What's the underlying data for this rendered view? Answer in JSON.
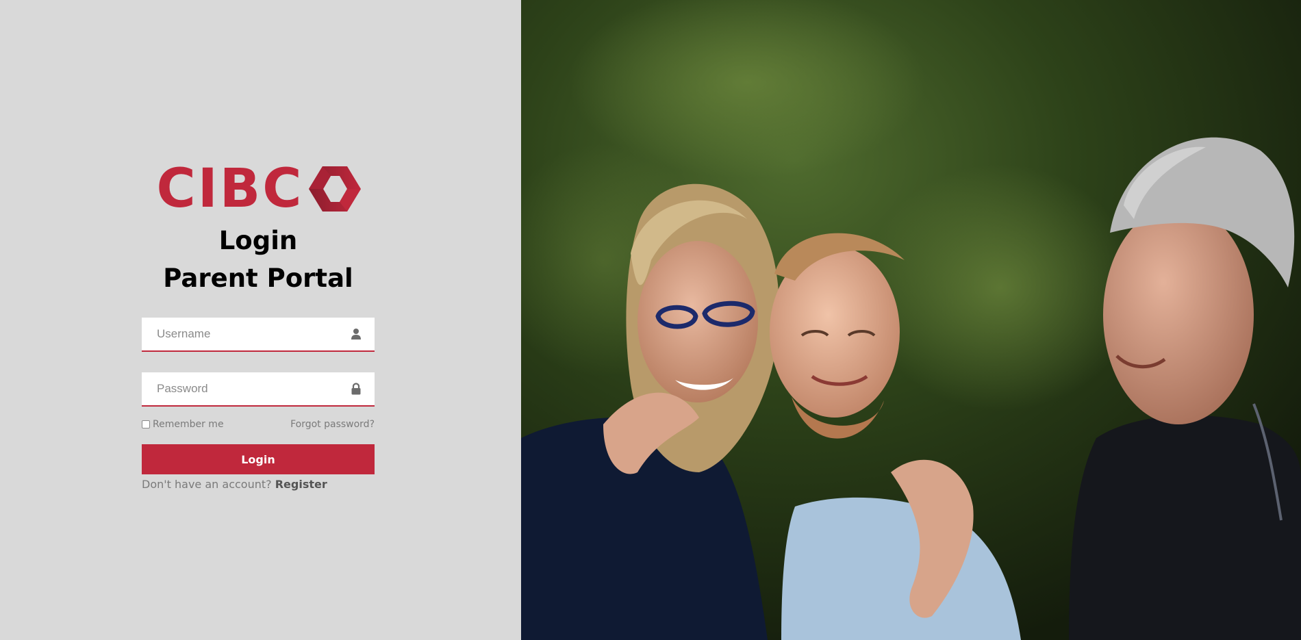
{
  "brand": {
    "logo_text": "CIBC",
    "color": "#c0283c",
    "color_dark": "#8c1d2e"
  },
  "login": {
    "title": "Login",
    "subtitle": "Parent Portal",
    "username_placeholder": "Username",
    "username_value": "",
    "password_placeholder": "Password",
    "password_value": "",
    "remember_label": "Remember me",
    "remember_checked": false,
    "forgot_label": "Forgot password?",
    "submit_label": "Login",
    "no_account_text": "Don't have an account?",
    "register_label": "Register"
  },
  "icons": {
    "username": "user-icon",
    "password": "lock-icon"
  },
  "photo": {
    "subject": "family-photo"
  }
}
